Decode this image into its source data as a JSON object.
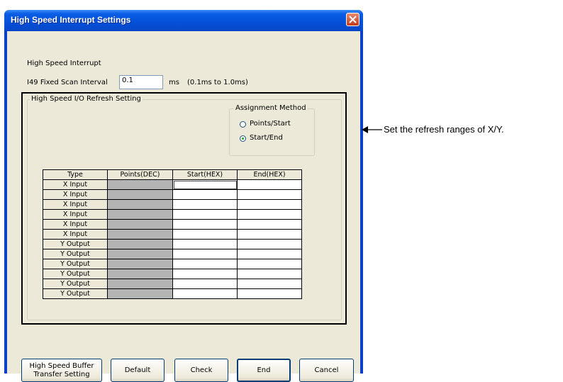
{
  "window": {
    "title": "High Speed Interrupt Settings"
  },
  "interrupt": {
    "heading": "High Speed Interrupt",
    "interval_label": "I49 Fixed Scan Interval",
    "interval_value": "0.1",
    "unit": "ms",
    "range": "(0.1ms to 1.0ms)"
  },
  "refresh": {
    "group_title": "High Speed I/O Refresh Setting",
    "assignment": {
      "title": "Assignment Method",
      "options": [
        "Points/Start",
        "Start/End"
      ],
      "selected": "Start/End"
    },
    "table": {
      "headers": [
        "Type",
        "Points(DEC)",
        "Start(HEX)",
        "End(HEX)"
      ],
      "rows": [
        {
          "type": "X Input",
          "points": "",
          "start": "",
          "end": ""
        },
        {
          "type": "X Input",
          "points": "",
          "start": "",
          "end": ""
        },
        {
          "type": "X Input",
          "points": "",
          "start": "",
          "end": ""
        },
        {
          "type": "X Input",
          "points": "",
          "start": "",
          "end": ""
        },
        {
          "type": "X Input",
          "points": "",
          "start": "",
          "end": ""
        },
        {
          "type": "X Input",
          "points": "",
          "start": "",
          "end": ""
        },
        {
          "type": "Y Output",
          "points": "",
          "start": "",
          "end": ""
        },
        {
          "type": "Y Output",
          "points": "",
          "start": "",
          "end": ""
        },
        {
          "type": "Y Output",
          "points": "",
          "start": "",
          "end": ""
        },
        {
          "type": "Y Output",
          "points": "",
          "start": "",
          "end": ""
        },
        {
          "type": "Y Output",
          "points": "",
          "start": "",
          "end": ""
        },
        {
          "type": "Y Output",
          "points": "",
          "start": "",
          "end": ""
        }
      ]
    }
  },
  "buttons": {
    "buffer_line1": "High Speed Buffer",
    "buffer_line2": "Transfer Setting",
    "default": "Default",
    "check": "Check",
    "end": "End",
    "cancel": "Cancel"
  },
  "annotation": "Set the refresh ranges of X/Y.",
  "icons": {
    "close": "close-icon",
    "arrow": "arrow-left-icon"
  },
  "colors": {
    "titlebar": "#0550d8",
    "dialog_bg": "#ece9d8",
    "close_button": "#c5381a",
    "highlight_border": "#000000"
  }
}
